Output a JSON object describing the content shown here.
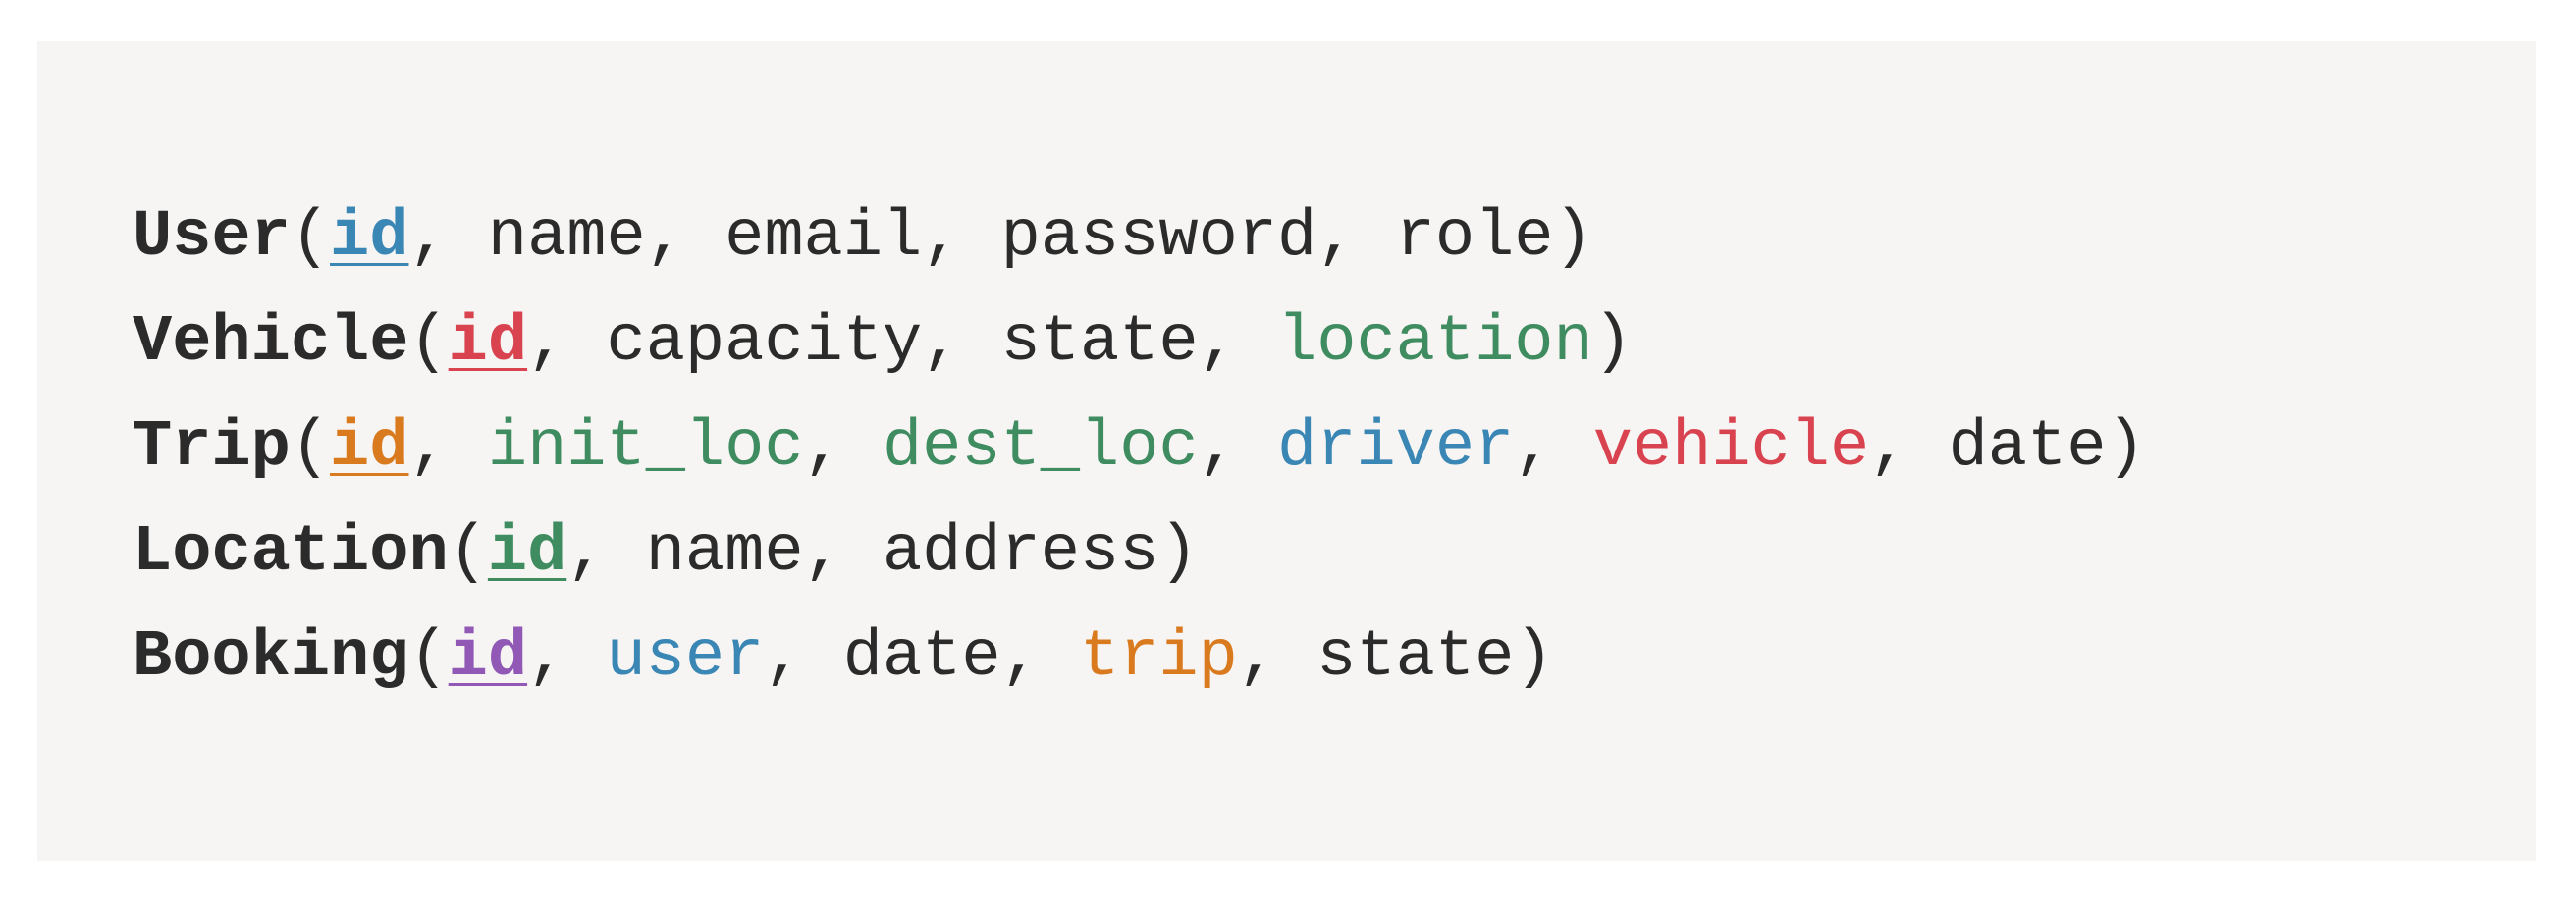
{
  "colors": {
    "text": "#2b2b2b",
    "blue": "#3a86b4",
    "red": "#d9434f",
    "orange": "#d97a1f",
    "green": "#3f8c60",
    "purple": "#9159b5",
    "panel_bg": "#f6f5f3"
  },
  "relations": [
    {
      "name": "User",
      "attributes": [
        {
          "text": "id",
          "primary_key": true,
          "color": "#3a86b4"
        },
        {
          "text": "name",
          "primary_key": false,
          "color": "#2b2b2b"
        },
        {
          "text": "email",
          "primary_key": false,
          "color": "#2b2b2b"
        },
        {
          "text": "password",
          "primary_key": false,
          "color": "#2b2b2b"
        },
        {
          "text": "role",
          "primary_key": false,
          "color": "#2b2b2b"
        }
      ]
    },
    {
      "name": "Vehicle",
      "attributes": [
        {
          "text": "id",
          "primary_key": true,
          "color": "#d9434f"
        },
        {
          "text": "capacity",
          "primary_key": false,
          "color": "#2b2b2b"
        },
        {
          "text": "state",
          "primary_key": false,
          "color": "#2b2b2b"
        },
        {
          "text": "location",
          "primary_key": false,
          "color": "#3f8c60"
        }
      ]
    },
    {
      "name": "Trip",
      "attributes": [
        {
          "text": "id",
          "primary_key": true,
          "color": "#d97a1f"
        },
        {
          "text": "init_loc",
          "primary_key": false,
          "color": "#3f8c60"
        },
        {
          "text": "dest_loc",
          "primary_key": false,
          "color": "#3f8c60"
        },
        {
          "text": "driver",
          "primary_key": false,
          "color": "#3a86b4"
        },
        {
          "text": "vehicle",
          "primary_key": false,
          "color": "#d9434f"
        },
        {
          "text": "date",
          "primary_key": false,
          "color": "#2b2b2b"
        }
      ]
    },
    {
      "name": "Location",
      "attributes": [
        {
          "text": "id",
          "primary_key": true,
          "color": "#3f8c60"
        },
        {
          "text": "name",
          "primary_key": false,
          "color": "#2b2b2b"
        },
        {
          "text": "address",
          "primary_key": false,
          "color": "#2b2b2b"
        }
      ]
    },
    {
      "name": "Booking",
      "attributes": [
        {
          "text": "id",
          "primary_key": true,
          "color": "#9159b5"
        },
        {
          "text": "user",
          "primary_key": false,
          "color": "#3a86b4"
        },
        {
          "text": "date",
          "primary_key": false,
          "color": "#2b2b2b"
        },
        {
          "text": "trip",
          "primary_key": false,
          "color": "#d97a1f"
        },
        {
          "text": "state",
          "primary_key": false,
          "color": "#2b2b2b"
        }
      ]
    }
  ]
}
